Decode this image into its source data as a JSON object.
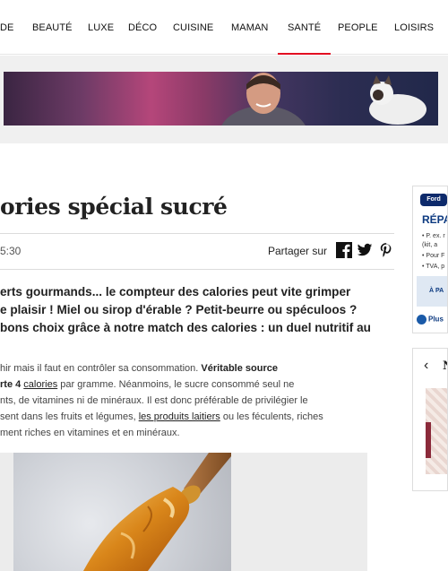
{
  "nav": {
    "items": [
      {
        "label": "DE",
        "active": false
      },
      {
        "label": "BEAUTÉ",
        "active": false
      },
      {
        "label": "LUXE",
        "active": false
      },
      {
        "label": "DÉCO",
        "active": false
      },
      {
        "label": "CUISINE",
        "active": false
      },
      {
        "label": "MAMAN",
        "active": false
      },
      {
        "label": "SANTÉ",
        "active": true
      },
      {
        "label": "PEOPLE",
        "active": false
      },
      {
        "label": "LOISIRS",
        "active": false
      }
    ]
  },
  "article": {
    "title": "ories spécial sucré",
    "date": "5:30",
    "share_label": "Partager sur",
    "intro": [
      "erts gourmands... le compteur des calories peut vite grimper",
      "e plaisir ! Miel ou sirop d'érable ? Petit-beurre ou spéculoos ?",
      "bons choix grâce à notre match des calories : un duel nutritif au"
    ],
    "body": {
      "l1_pre": "hir mais il faut en contrôler sa consommation. ",
      "l1_bold": "Véritable source",
      "l2_bold_a": "rte 4 ",
      "l2_link": "calories",
      "l2_post": " par gramme. Néanmoins, le sucre consommé seul ne",
      "l3": "nts, de vitamines ni de minéraux. Il est donc préférable de privilégier le",
      "l4_pre": "sent dans les fruits et légumes, ",
      "l4_link": "les produits laitiers",
      "l4_post": " ou les féculents, riches",
      "l5": "ment riches en vitamines et en minéraux."
    }
  },
  "sidebar_ad": {
    "brand": "Ford",
    "heading": "RÉPA",
    "lines": [
      "• P. ex. r",
      "(kit, a",
      "• Pour F",
      "• TVA, p"
    ],
    "cta": "À PA",
    "plus": "Plus"
  },
  "sidebar_widget": {
    "arrow": "‹",
    "title": "N"
  },
  "colors": {
    "accent": "#e20a20",
    "ad_blue": "#0d3a80"
  }
}
